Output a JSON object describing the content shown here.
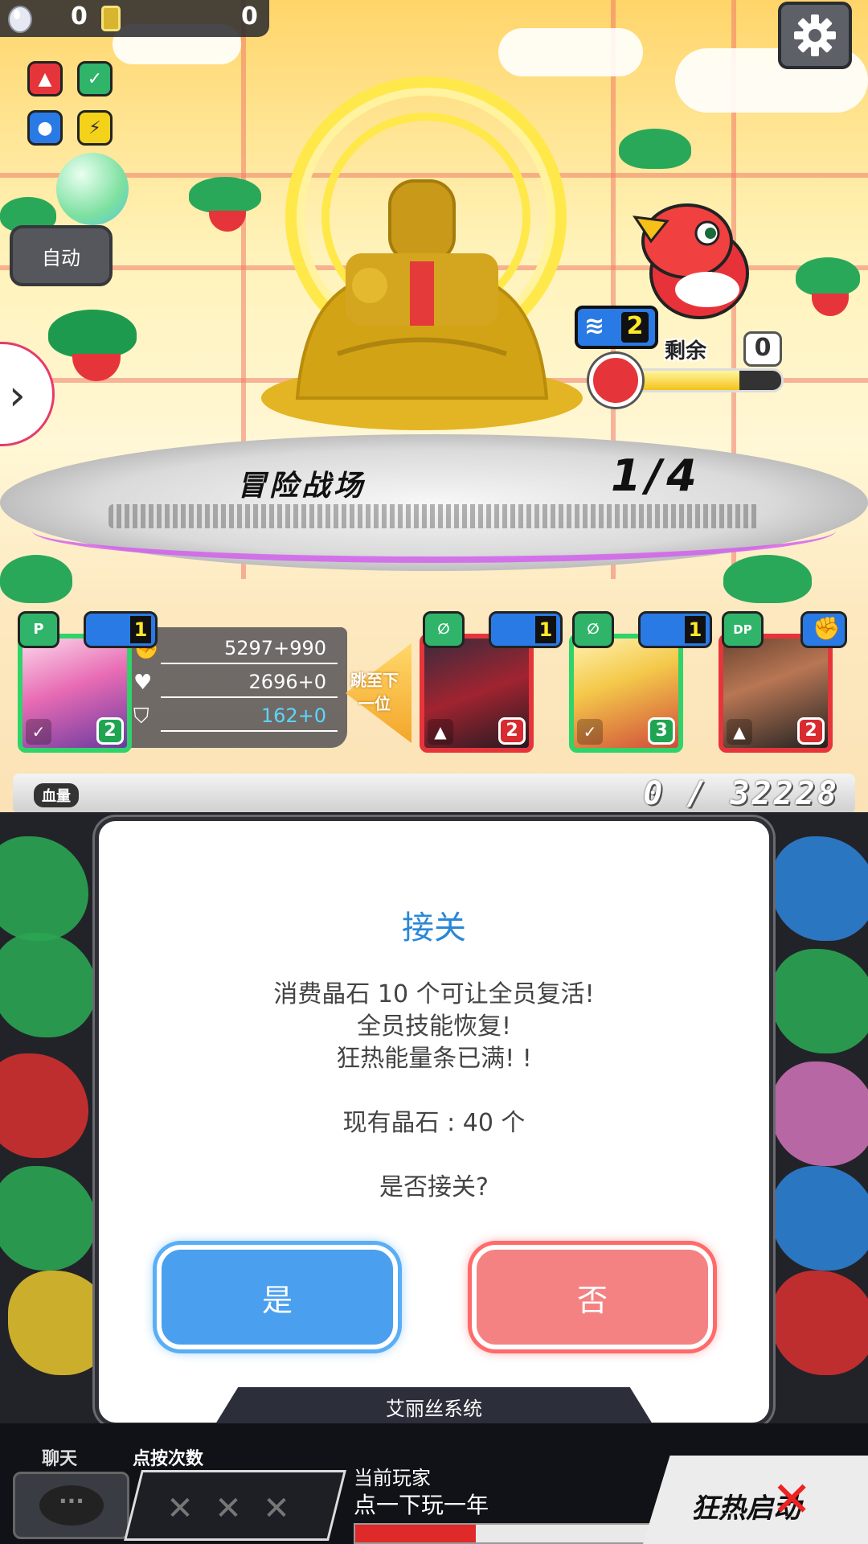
{
  "topbar": {
    "gem_count": "0",
    "coin_count": "0"
  },
  "elements_legend": [
    "fire",
    "wood",
    "water",
    "light"
  ],
  "auto_button": "自动",
  "side_expand": "›",
  "enemy": {
    "run_count": "2",
    "remaining_label": "剩余",
    "remaining_count": "0",
    "hp_fraction": 0.7
  },
  "stage": {
    "title": "冒险战场",
    "progress": "1/4"
  },
  "party": {
    "leader": {
      "skill_icon": "P",
      "shield_count": "1",
      "level": "2",
      "element": "wood",
      "attack": "5297+990",
      "hp": "2696+0",
      "defense": "162+0"
    },
    "members": [
      {
        "skill_icon": "∅",
        "shield_count": "1",
        "level": "2",
        "element": "fire"
      },
      {
        "skill_icon": "∅",
        "shield_count": "1",
        "level": "3",
        "element": "wood"
      },
      {
        "skill_icon": "DP",
        "shield_count": "",
        "level": "2",
        "element": "fire"
      }
    ],
    "jump_label": "跳至下一位"
  },
  "hp_bar": {
    "label": "血量",
    "value": "0 / 32228"
  },
  "dialog": {
    "title": "接关",
    "line1": "消费晶石 10 个可让全员复活!",
    "line2": "全员技能恢复!",
    "line3": "狂热能量条已满! !",
    "line4": "现有晶石 : 40 个",
    "question": "是否接关?",
    "yes": "是",
    "no": "否",
    "footer": "艾丽丝系统"
  },
  "bottom": {
    "chat_label": "聊天",
    "chat_icon": "···",
    "taps_label": "点按次数",
    "taps_marks": [
      "✕",
      "✕",
      "✕"
    ],
    "player_label": "当前玩家",
    "player_name": "点一下玩一年",
    "player_progress": 0.4,
    "fever_label": "狂热启动",
    "fever_mark": "✕"
  },
  "colors": {
    "fire": "#e5353a",
    "wood": "#2fd36a",
    "water": "#2a7ae6",
    "light": "#f4d21a"
  }
}
